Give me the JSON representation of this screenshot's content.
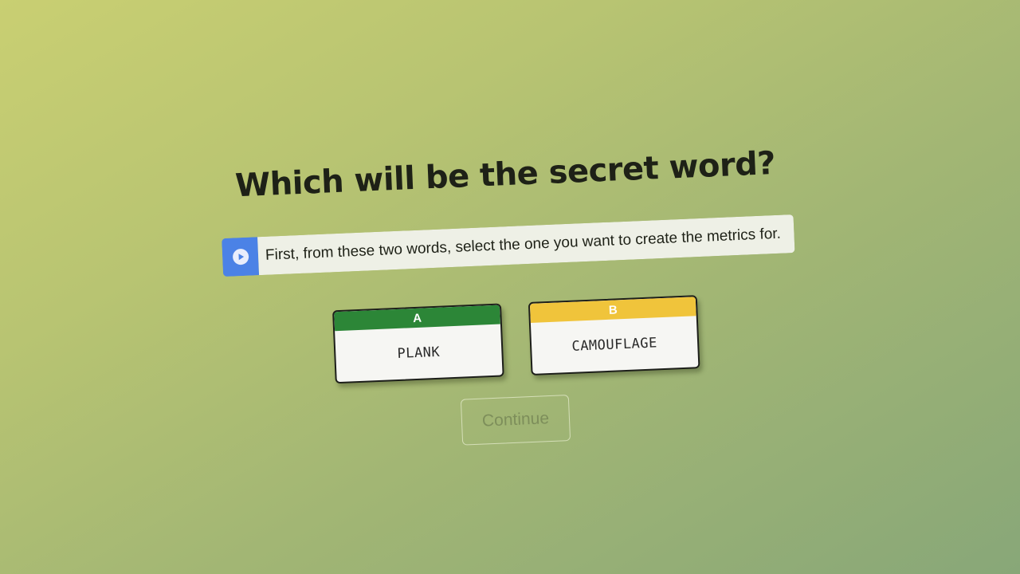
{
  "title": "Which will be the secret word?",
  "instruction": {
    "text": "First, from these two words, select the one you want to create the metrics for.",
    "play_icon": "play-circle-icon"
  },
  "options": [
    {
      "label": "A",
      "word": "PLANK",
      "color": "#2c8637"
    },
    {
      "label": "B",
      "word": "CAMOUFLAGE",
      "color": "#f0c43b"
    }
  ],
  "continue_label": "Continue",
  "colors": {
    "play_button": "#4b82e6"
  }
}
